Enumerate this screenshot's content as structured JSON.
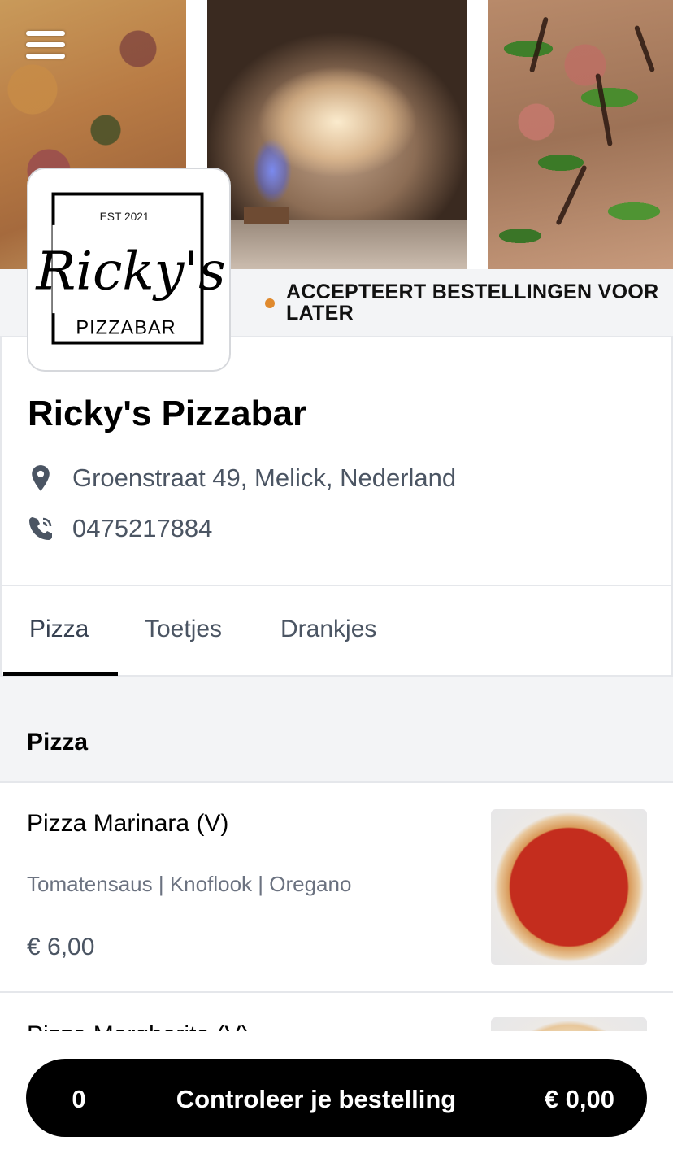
{
  "header": {
    "menu_icon": "hamburger-menu-icon"
  },
  "logo": {
    "established": "EST 2021",
    "script_name": "Ricky's",
    "wordmark": "PIZZABAR"
  },
  "status": {
    "text": "ACCEPTEERT BESTELLINGEN VOOR LATER",
    "dot_color": "#e08a2e"
  },
  "restaurant": {
    "name": "Ricky's Pizzabar",
    "address": "Groenstraat 49, Melick, Nederland",
    "phone": "0475217884",
    "address_icon": "map-pin-icon",
    "phone_icon": "phone-icon"
  },
  "tabs": [
    {
      "label": "Pizza",
      "active": true
    },
    {
      "label": "Toetjes",
      "active": false
    },
    {
      "label": "Drankjes",
      "active": false
    }
  ],
  "section": {
    "title": "Pizza"
  },
  "items": [
    {
      "name": "Pizza Marinara (V)",
      "description": "Tomatensaus | Knoflook | Oregano",
      "price": "€ 6,00"
    },
    {
      "name": "Pizza Margherita (V)"
    }
  ],
  "cart": {
    "count": "0",
    "label": "Controleer je bestelling",
    "total": "€ 0,00"
  },
  "colors": {
    "accent": "#000000",
    "muted_text": "#4b5563",
    "background_gray": "#f3f4f6"
  }
}
